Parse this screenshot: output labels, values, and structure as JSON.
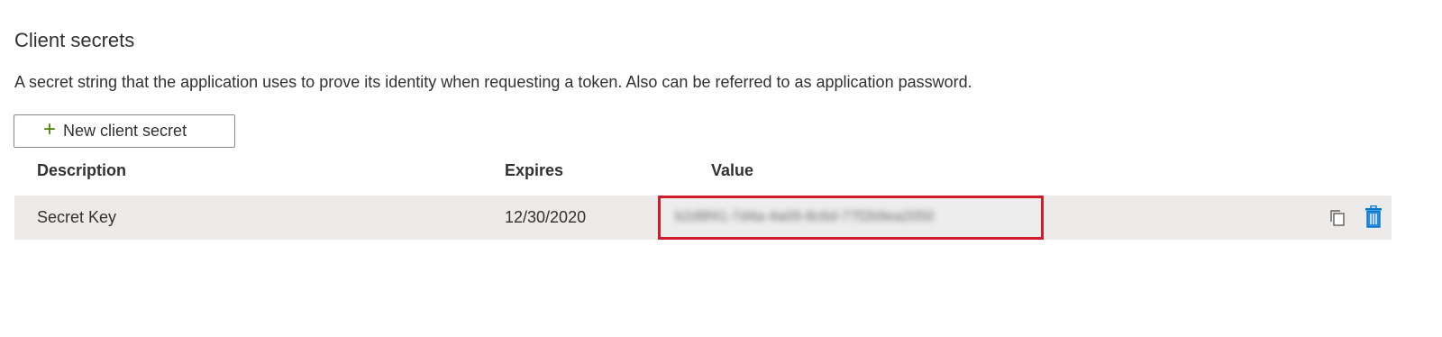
{
  "section": {
    "title": "Client secrets",
    "description": "A secret string that the application uses to prove its identity when requesting a token. Also can be referred to as application password."
  },
  "toolbar": {
    "new_button_label": "New client secret",
    "new_button_icon": "plus-icon"
  },
  "table": {
    "columns": [
      "Description",
      "Expires",
      "Value"
    ],
    "rows": [
      {
        "description": "Secret Key",
        "expires": "12/30/2020",
        "value": "b2d8f41-7d4a-4a09-8c6d-77f2b9ea2050",
        "value_obscured": true,
        "actions": [
          "copy-icon",
          "delete-icon"
        ]
      }
    ]
  },
  "colors": {
    "highlight_border": "#d01c2a",
    "row_background": "#edebe9",
    "accent_blue": "#0078d4",
    "plus_green": "#498205"
  }
}
